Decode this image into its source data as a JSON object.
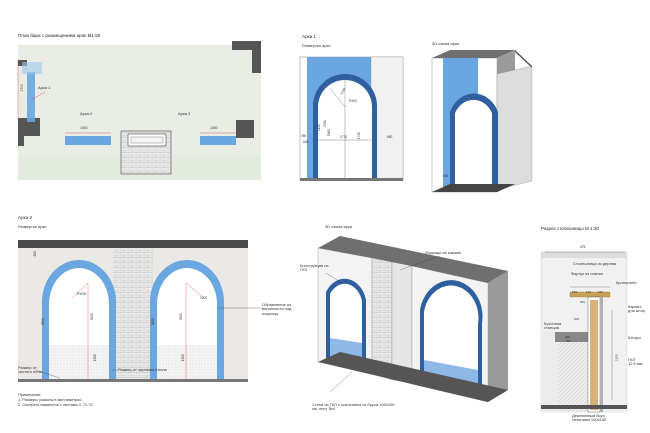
{
  "top": {
    "plan_title": "План бара с размещением арок  М1:50",
    "arch1_title": "Арка 1",
    "arch1_unfold_label": "Развертка арки",
    "arch1_3d_label": "3D схема арки",
    "plan_arch1": "Арка 1",
    "plan_arch2_left": "Арка 2",
    "plan_arch2_right": "Арка 2",
    "plan_dims": [
      "1000",
      "1000",
      "1700"
    ],
    "arch1_dims": [
      "2760",
      "3360",
      "4140",
      "2150",
      "R300",
      "350",
      "1770",
      "1730",
      "650",
      "600",
      "400"
    ]
  },
  "arch2": {
    "title": "Арка 2",
    "unfold_label": "Развертка арки",
    "label_3d": "3D схема арки",
    "dims": [
      "820",
      "1000",
      "3450",
      "3300",
      "3392",
      "2620",
      "1500",
      "1350",
      "R1000"
    ],
    "callouts": {
      "frame": "Обрамление из\nвинипласта под\nпокраску",
      "finish_floor": "Размер от\nчистого пола",
      "rough_floor": "Размер от черневого пола",
      "gkl_construction": "Конструкция из\nГКЛ",
      "stone_facing": "Изразцы на камине",
      "wall_note": "Стена из ГКЛ с усилением из бруса 100х100\nсм. лист №4"
    },
    "notes": [
      "Примечания:",
      "1. Размеры указаны в миллиметрах.",
      "2. Смотреть совместно с листами 4, 72-75."
    ]
  },
  "counter": {
    "title": "Разрез столешницы М 1:20",
    "labels": {
      "counter_top": "Столешница из дерева",
      "apron": "Фартук из плитки",
      "bracket": "Кронштейн",
      "niche": "Карниз\nдля штор",
      "kitchen": "Кухонная\nстанция",
      "curtains": "Шторы",
      "gkl": "ГКЛ\n12,5 мм",
      "beam": "Деревянный брус\nсечением 100х100"
    },
    "dims": [
      "675",
      "150",
      "100",
      "150",
      "560",
      "200",
      "400",
      "300",
      "1200"
    ]
  },
  "colors": {
    "wall_blue": "#6aa6e0",
    "wall_grey": "#8d8d8d",
    "dark_frame": "#4a4a4a",
    "floor_green": "#eef3e9",
    "light_face": "#ebe9e6"
  }
}
